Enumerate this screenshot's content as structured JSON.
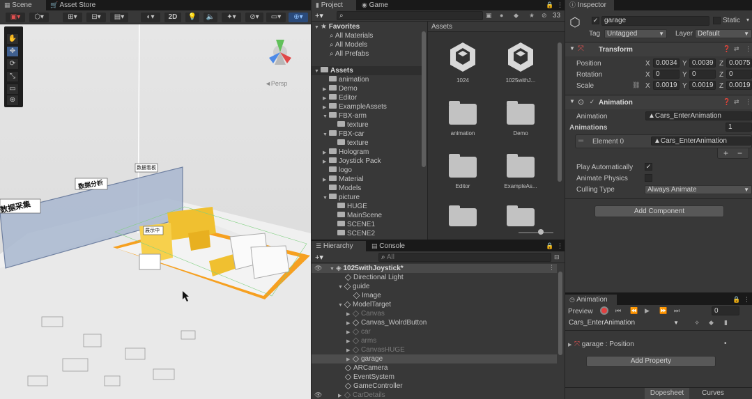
{
  "scene": {
    "tabs": {
      "scene": "Scene",
      "asset_store": "Asset Store"
    },
    "toolbar": {
      "mode_2d": "2D"
    },
    "persp": "◄Persp",
    "labels": {
      "data_collect": "数据采集",
      "data_analysis": "数据分析",
      "label3": "数据看板",
      "label4": "展示中"
    }
  },
  "project": {
    "tabs": {
      "project": "Project",
      "game": "Game"
    },
    "add": "+▾",
    "hidden_count": "33",
    "favorites": {
      "title": "Favorites",
      "items": [
        "All Materials",
        "All Models",
        "All Prefabs"
      ]
    },
    "assets_root": "Assets",
    "tree": [
      "animation",
      "Demo",
      "Editor",
      "ExampleAssets",
      "FBX-arm",
      "texture",
      "FBX-car",
      "texture",
      "Hologram",
      "Joystick Pack",
      "logo",
      "Material",
      "Models",
      "picture",
      "HUGE",
      "MainScene",
      "SCENE1",
      "SCENE2"
    ],
    "grid_header": "Assets",
    "grid": [
      "1024",
      "1025withJ...",
      "animation",
      "Demo",
      "Editor",
      "ExampleAs..."
    ]
  },
  "hierarchy": {
    "tabs": {
      "hierarchy": "Hierarchy",
      "console": "Console"
    },
    "add": "+▾",
    "search_placeholder": "All",
    "scene_name": "1025withJoystick*",
    "items": [
      "Directional Light",
      "guide",
      "Image",
      "ModelTarget",
      "Canvas",
      "Canvas_WolrdButton",
      "car",
      "arms",
      "CanvasHUGE",
      "garage",
      "ARCamera",
      "EventSystem",
      "GameController",
      "CarDetails"
    ]
  },
  "inspector": {
    "tab": "Inspector",
    "object_name": "garage",
    "static_label": "Static",
    "tag_label": "Tag",
    "tag_value": "Untagged",
    "layer_label": "Layer",
    "layer_value": "Default",
    "transform": {
      "title": "Transform",
      "position_label": "Position",
      "rotation_label": "Rotation",
      "scale_label": "Scale",
      "position": {
        "x": "0.0034",
        "y": "0.0039",
        "z": "0.0075"
      },
      "rotation": {
        "x": "0",
        "y": "0",
        "z": "0"
      },
      "scale": {
        "x": "0.0019",
        "y": "0.0019",
        "z": "0.0019"
      }
    },
    "animation": {
      "title": "Animation",
      "animation_label": "Animation",
      "animation_value": "Cars_EnterAnimation",
      "animations_label": "Animations",
      "animations_count": "1",
      "element_label": "Element 0",
      "element_value": "Cars_EnterAnimation",
      "play_auto_label": "Play Automatically",
      "animate_physics_label": "Animate Physics",
      "culling_label": "Culling Type",
      "culling_value": "Always Animate"
    },
    "add_component": "Add Component"
  },
  "anim_window": {
    "tab": "Animation",
    "preview": "Preview",
    "frame": "0",
    "clip": "Cars_EnterAnimation",
    "property": "garage : Position",
    "add_property": "Add Property",
    "dopesheet": "Dopesheet",
    "curves": "Curves"
  }
}
